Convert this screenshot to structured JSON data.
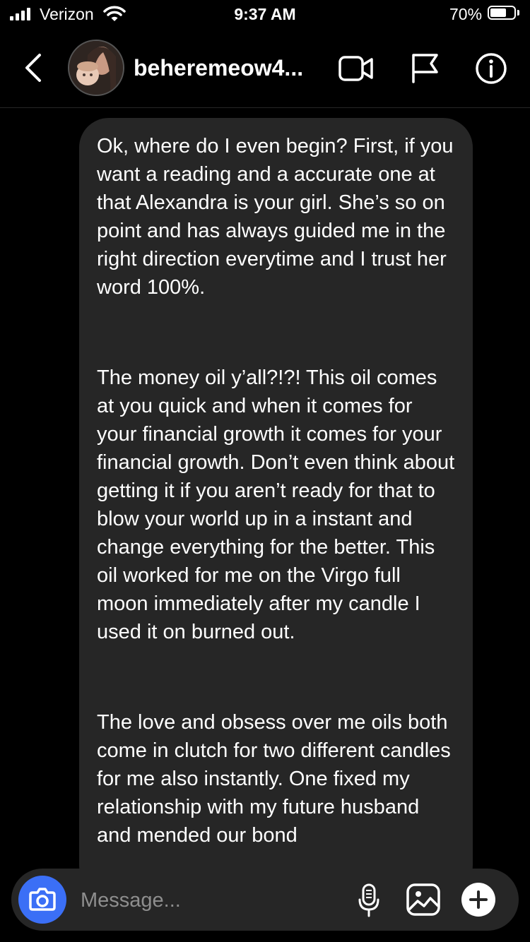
{
  "status_bar": {
    "carrier": "Verizon",
    "time": "9:37 AM",
    "battery_percent": "70%",
    "battery_level": 0.7
  },
  "header": {
    "username": "beheremeow4...",
    "icons": [
      "back-chevron-icon",
      "video-call-icon",
      "flag-icon",
      "info-icon"
    ]
  },
  "message": {
    "paragraphs": [
      "Ok, where do I even begin? First, if you want a reading and a accurate one at that Alexandra is your girl. She’s so on point and has always guided me in the right direction everytime and I trust her word 100%.",
      "The money oil y’all?!?! This oil comes at you quick and when it comes for your financial growth it comes for your financial growth. Don’t even think about getting it if you aren’t ready for that to blow your world up in a instant and change everything for the better. This oil worked for me on the Virgo full moon immediately after my candle I used it on burned out.",
      "The love and obsess over me oils both come in clutch for two different candles for me also instantly. One fixed my relationship with my future husband and mended our bond"
    ]
  },
  "composer": {
    "placeholder": "Message...",
    "accent_color": "#3b6ff6",
    "icons": [
      "camera-icon",
      "microphone-icon",
      "gallery-icon",
      "plus-icon"
    ]
  }
}
